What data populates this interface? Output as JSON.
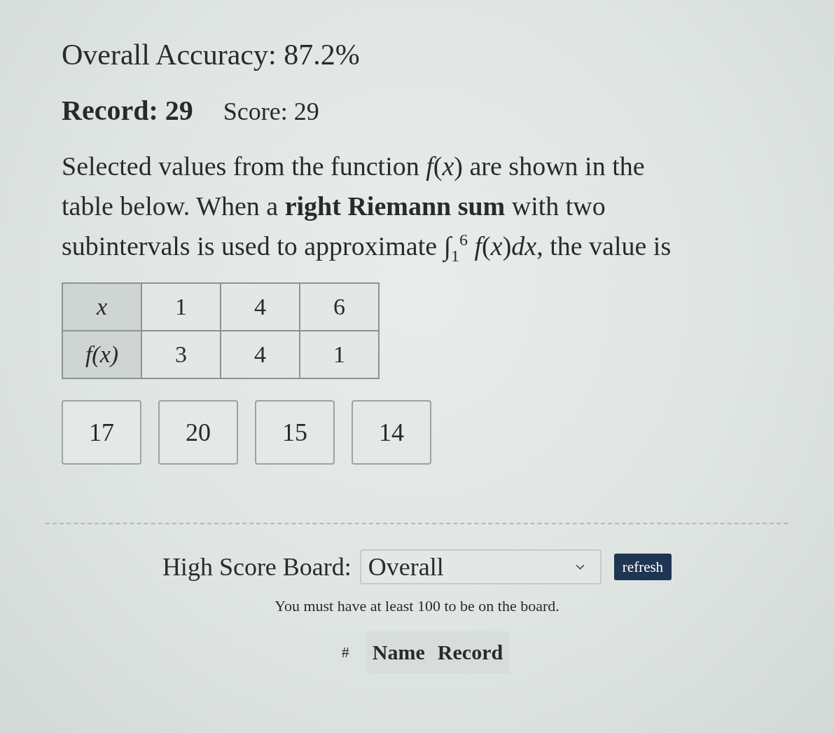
{
  "stats": {
    "accuracy": "Overall Accuracy: 87.2%",
    "record": "Record: 29",
    "score": "Score: 29"
  },
  "question": {
    "text": "Selected values from the function *f*(*x*) are shown in the table below. When a **right Riemann sum** with two subintervals is used to approximate ∫$_{1}$$^{6}$ *f*(*x*)*dx*, the value is",
    "table": {
      "rows": [
        {
          "header": "x",
          "cells": [
            "1",
            "4",
            "6"
          ]
        },
        {
          "header": "f(x)",
          "cells": [
            "3",
            "4",
            "1"
          ]
        }
      ]
    },
    "choices": [
      {
        "label": "17",
        "selected": false
      },
      {
        "label": "20",
        "selected": false
      },
      {
        "label": "15",
        "selected": false
      },
      {
        "label": "14",
        "selected": false
      }
    ]
  },
  "leaderboard": {
    "label": "High Score Board:",
    "select": {
      "value": "Overall"
    },
    "refresh": "refresh",
    "note": "You must have at least 100 to be on the board.",
    "columns": [
      "#",
      "Name",
      "Record"
    ]
  }
}
